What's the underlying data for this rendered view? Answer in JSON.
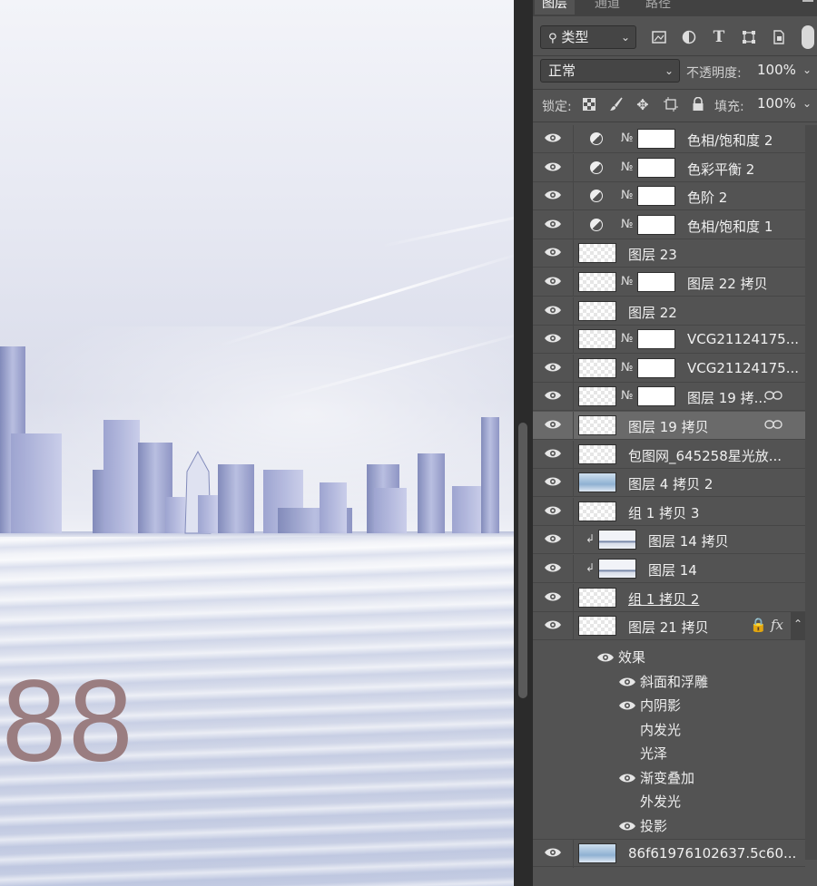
{
  "canvas": {
    "big_number": "88",
    "colors": {
      "number": "#9a7d80",
      "buildings": "#8c93c0",
      "sky": "#e6e8f2"
    }
  },
  "panel": {
    "tabs": [
      {
        "label": "图层",
        "active": true
      },
      {
        "label": "通道",
        "active": false
      },
      {
        "label": "路径",
        "active": false
      }
    ],
    "filter": {
      "label": "类型",
      "icon": "search-icon"
    },
    "filter_icons": [
      "image-filter-icon",
      "adjustment-filter-icon",
      "type-filter-icon",
      "shape-filter-icon",
      "smart-object-filter-icon"
    ],
    "blend_mode": "正常",
    "opacity_label": "不透明度:",
    "opacity_value": "100%",
    "lock_label": "锁定:",
    "lock_icons": [
      "lock-transparent-icon",
      "lock-paint-icon",
      "lock-move-icon",
      "lock-artboard-icon",
      "lock-all-icon"
    ],
    "fill_label": "填充:",
    "fill_value": "100%",
    "layers": [
      {
        "name": "色相/饱和度 2",
        "kind": "adjustment"
      },
      {
        "name": "色彩平衡 2",
        "kind": "adjustment"
      },
      {
        "name": "色阶 2",
        "kind": "adjustment"
      },
      {
        "name": "色相/饱和度 1",
        "kind": "adjustment"
      },
      {
        "name": "图层 23",
        "kind": "pixel"
      },
      {
        "name": "图层 22 拷贝",
        "kind": "masked"
      },
      {
        "name": "图层 22",
        "kind": "pixel"
      },
      {
        "name": "VCG21124175...",
        "kind": "masked"
      },
      {
        "name": "VCG21124175...",
        "kind": "masked"
      },
      {
        "name": "图层 19 拷...",
        "kind": "masked",
        "linked": true
      },
      {
        "name": "图层 19 拷贝",
        "kind": "pixel",
        "linked": true,
        "selected": true
      },
      {
        "name": "包图网_645258星光放...",
        "kind": "pixel"
      },
      {
        "name": "图层 4 拷贝 2",
        "kind": "pixel"
      },
      {
        "name": "组 1 拷贝 3",
        "kind": "pixel"
      },
      {
        "name": "图层 14 拷贝",
        "kind": "clipped"
      },
      {
        "name": "图层 14",
        "kind": "clipped"
      },
      {
        "name": "组 1 拷贝 2",
        "kind": "pixel",
        "underline": true
      },
      {
        "name": "图层 21 拷贝",
        "kind": "fx",
        "fx_label": "fx"
      }
    ],
    "effects_header": "效果",
    "effects": [
      {
        "name": "斜面和浮雕",
        "visible": true
      },
      {
        "name": "内阴影",
        "visible": true
      },
      {
        "name": "内发光",
        "visible": false
      },
      {
        "name": "光泽",
        "visible": false
      },
      {
        "name": "渐变叠加",
        "visible": true
      },
      {
        "name": "外发光",
        "visible": false
      },
      {
        "name": "投影",
        "visible": true
      }
    ],
    "bottom_layer": {
      "name": "86f61976102637.5c60..."
    }
  }
}
